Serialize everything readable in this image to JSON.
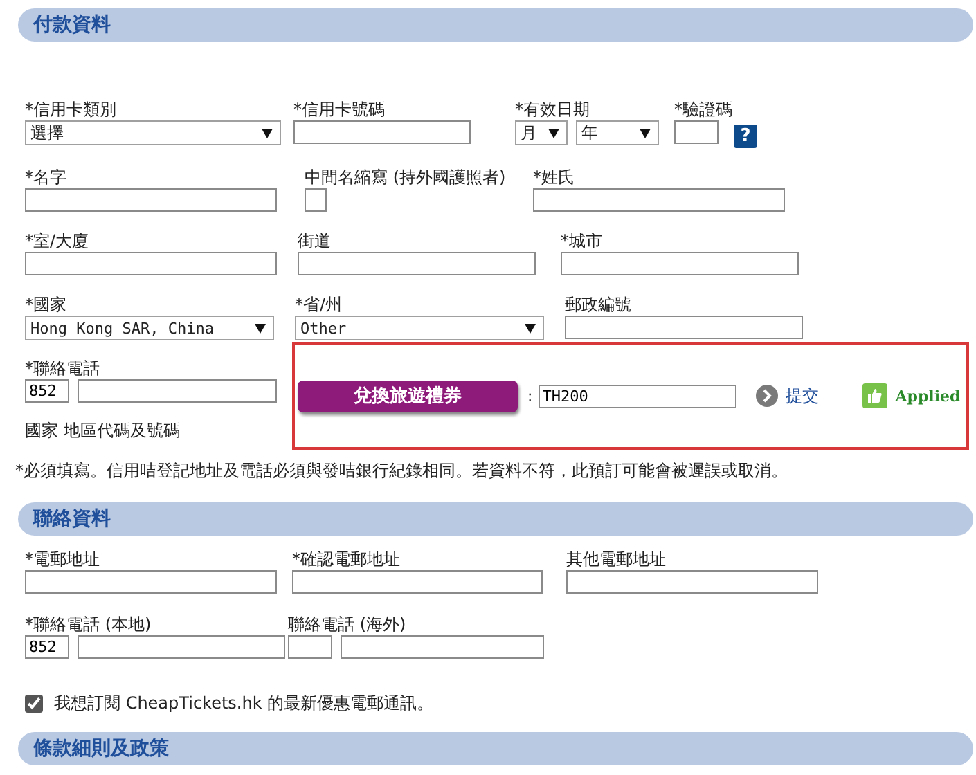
{
  "payment": {
    "title": "付款資料",
    "rows": [
      [
        {
          "kind": "select",
          "label": "*信用卡類別",
          "value": "選擇"
        },
        {
          "kind": "input",
          "label": "*信用卡號碼"
        },
        {
          "kind": "date",
          "label": "*有效日期",
          "options": [
            "月",
            "年"
          ]
        },
        {
          "kind": "cvv",
          "label": "*驗證碼",
          "help": "?"
        }
      ],
      [
        {
          "kind": "input",
          "label": "*名字"
        },
        {
          "kind": "checkbox",
          "label": "中間名縮寫 (持外國護照者)",
          "checked": false
        },
        {
          "kind": "input",
          "label": "*姓氏"
        }
      ],
      [
        {
          "kind": "input",
          "label": "*室/大廈"
        },
        {
          "kind": "input",
          "label": "街道"
        },
        {
          "kind": "input",
          "label": "*城市"
        }
      ],
      [
        {
          "kind": "select",
          "label": "*國家",
          "value": "Hong Kong SAR, China"
        },
        {
          "kind": "select",
          "label": "*省/州",
          "value": "Other"
        },
        {
          "kind": "input",
          "label": "郵政編號"
        }
      ]
    ],
    "phone": {
      "label": "*聯絡電話",
      "code": "852",
      "note": "國家 地區代碼及號碼"
    },
    "voucher": {
      "button": "兌換旅遊禮券",
      "separator": ":",
      "code": "TH200",
      "submit": "提交",
      "status": "Applied"
    },
    "footnote": "*必須填寫。信用咭登記地址及電話必須與發咭銀行紀錄相同。若資料不符，此預訂可能會被遲誤或取消。"
  },
  "contact": {
    "title": "聯絡資料",
    "rows": [
      [
        {
          "kind": "input",
          "label": "*電郵地址"
        },
        {
          "kind": "input",
          "label": "*確認電郵地址"
        },
        {
          "kind": "input",
          "label": "其他電郵地址"
        }
      ],
      [
        {
          "kind": "phone",
          "label": "*聯絡電話 (本地)",
          "code": "852"
        },
        {
          "kind": "phone",
          "label": "聯絡電話 (海外)"
        }
      ]
    ]
  },
  "subscribe": {
    "checked": true,
    "text": "我想訂閱 CheapTickets.hk 的最新優惠電郵通訊。"
  },
  "terms": {
    "title": "條款細則及政策"
  }
}
